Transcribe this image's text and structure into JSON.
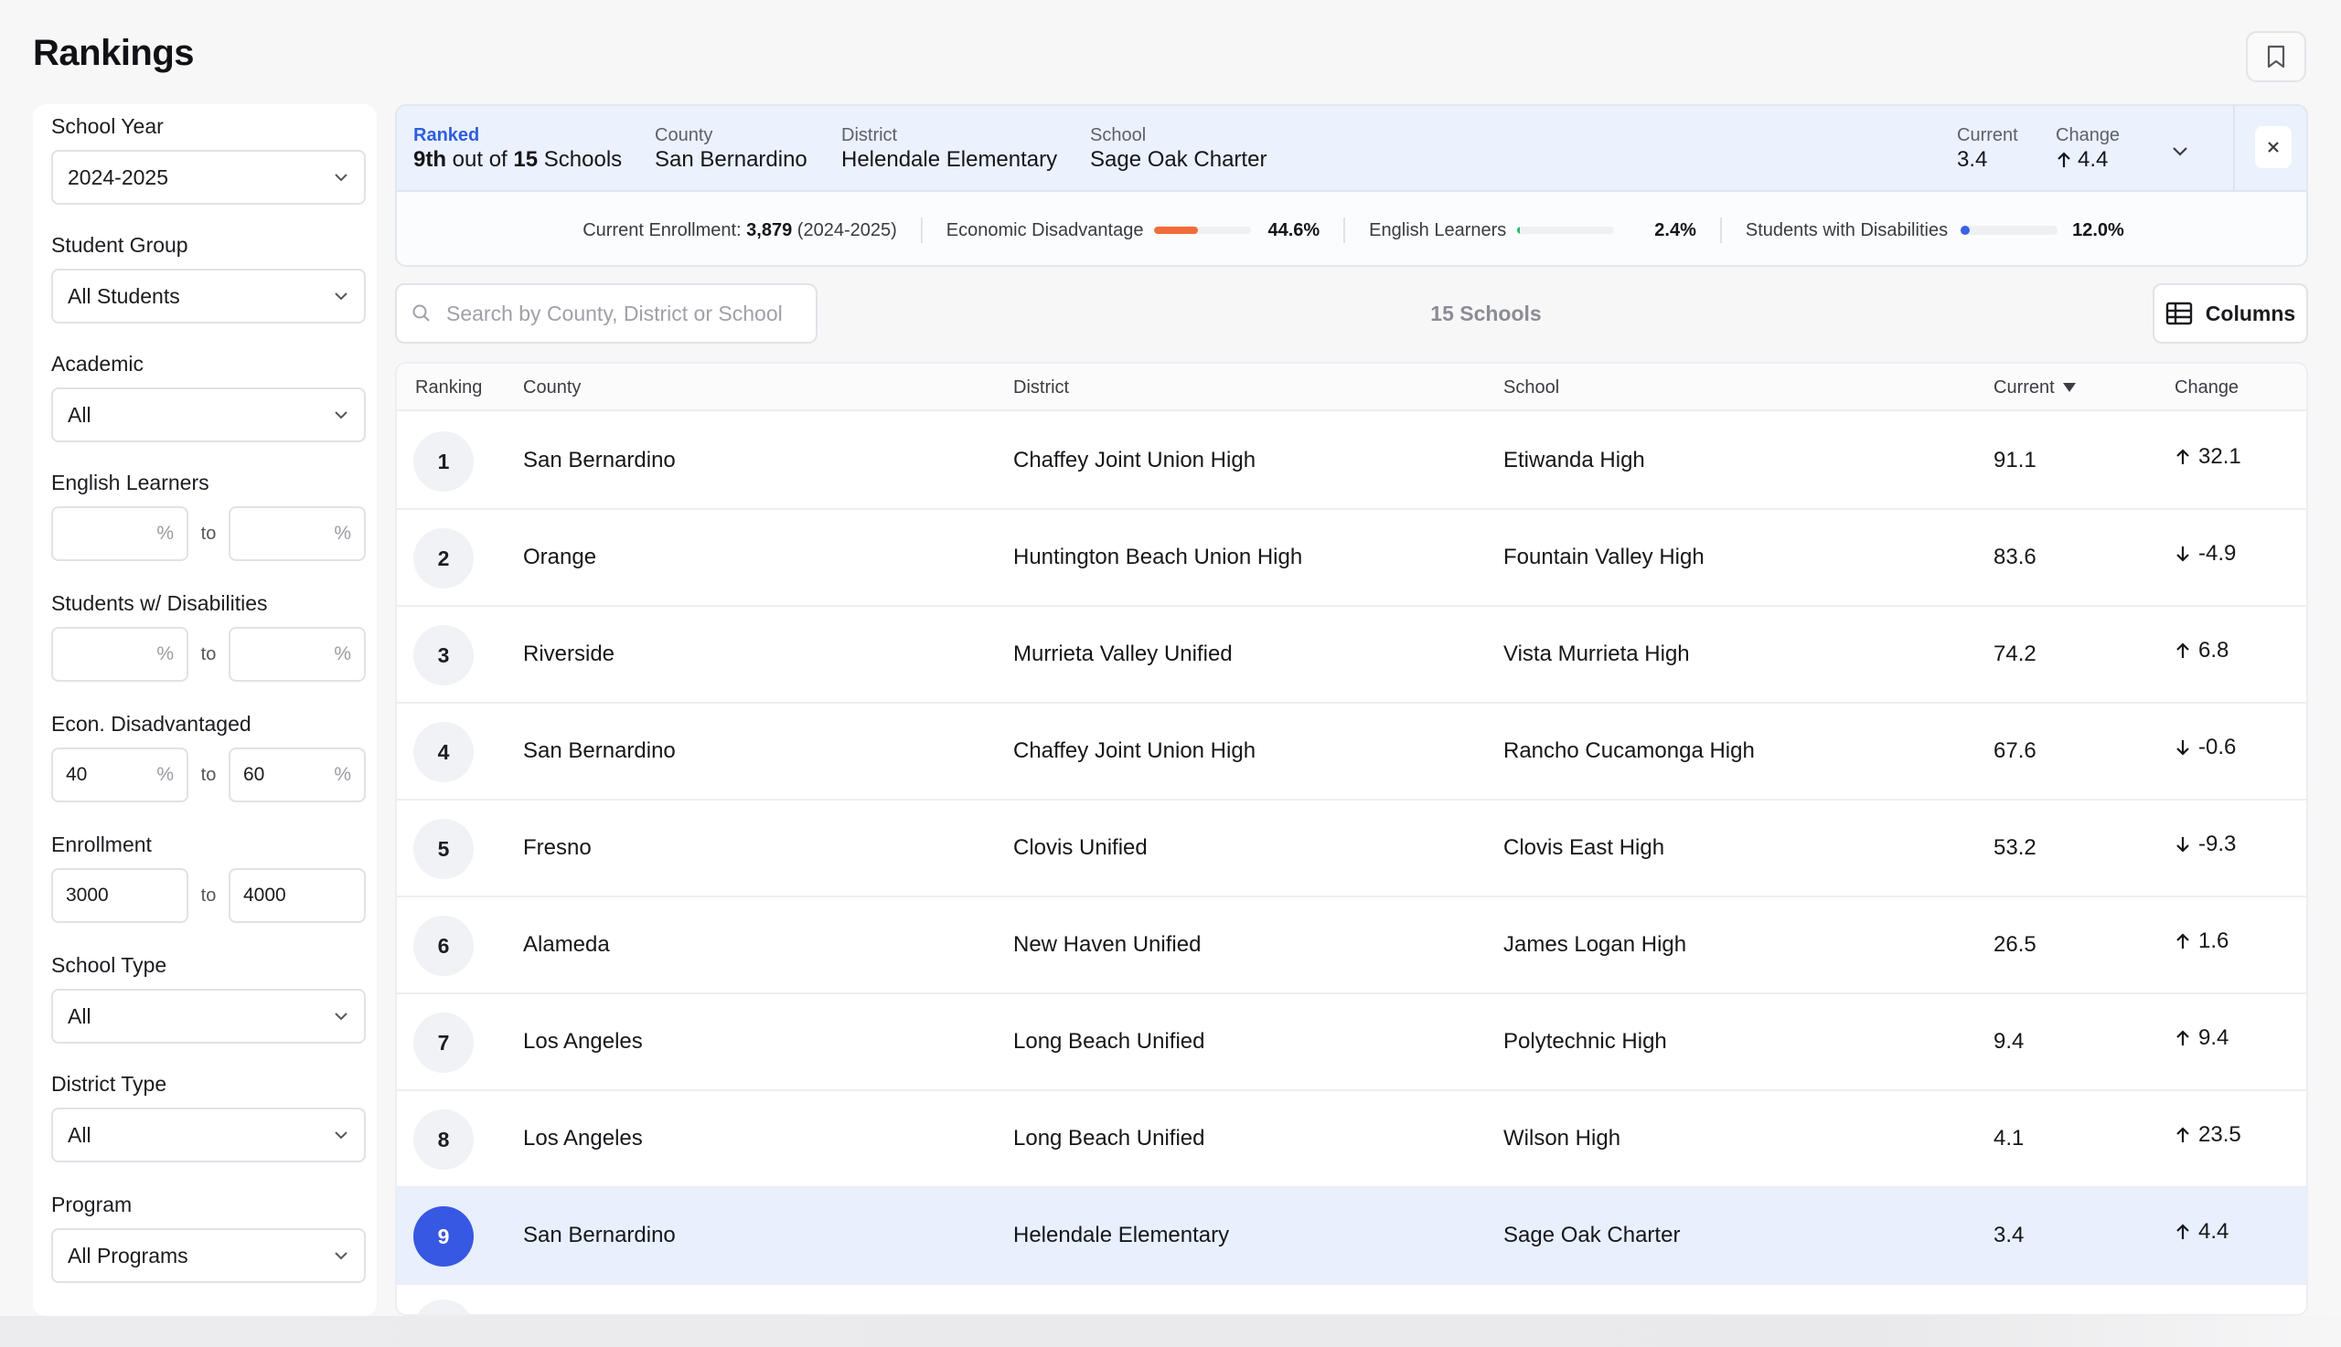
{
  "page": {
    "title": "Rankings"
  },
  "filters": {
    "school_year": {
      "label": "School Year",
      "value": "2024-2025"
    },
    "student_group": {
      "label": "Student Group",
      "value": "All Students"
    },
    "academic": {
      "label": "Academic",
      "value": "All"
    },
    "english_learners": {
      "label": "English Learners",
      "from": "",
      "to": "",
      "unit": "%",
      "to_label": "to"
    },
    "disabilities": {
      "label": "Students w/ Disabilities",
      "from": "",
      "to": "",
      "unit": "%",
      "to_label": "to"
    },
    "econ": {
      "label": "Econ. Disadvantaged",
      "from": "40",
      "to": "60",
      "unit": "%",
      "to_label": "to"
    },
    "enrollment": {
      "label": "Enrollment",
      "from": "3000",
      "to": "4000",
      "to_label": "to"
    },
    "school_type": {
      "label": "School Type",
      "value": "All"
    },
    "district_type": {
      "label": "District Type",
      "value": "All"
    },
    "program": {
      "label": "Program",
      "value": "All Programs"
    }
  },
  "summary": {
    "ranked_label": "Ranked",
    "ranked_position": "9th",
    "ranked_out_of_text": "out of",
    "ranked_total": "15",
    "ranked_schools_text": "Schools",
    "county_label": "County",
    "county": "San Bernardino",
    "district_label": "District",
    "district": "Helendale Elementary",
    "school_label": "School",
    "school": "Sage Oak Charter",
    "current_label": "Current",
    "current": "3.4",
    "change_label": "Change",
    "change": "4.4",
    "enrollment_label": "Current Enrollment:",
    "enrollment_value": "3,879",
    "enrollment_year": "(2024-2025)",
    "econ_label": "Economic Disadvantage",
    "econ_value": "44.6%",
    "econ_fraction": 0.446,
    "el_label": "English Learners",
    "el_value": "2.4%",
    "el_fraction": 0.024,
    "swd_label": "Students with Disabilities",
    "swd_value": "12.0%",
    "colors": {
      "econ": "#f26b3a",
      "el": "#2fb36a",
      "swd": "#3b63e6",
      "accent": "#3758e3"
    }
  },
  "toolbar": {
    "search_placeholder": "Search by County, District or School",
    "count": "15 Schools",
    "columns_label": "Columns"
  },
  "table": {
    "headers": {
      "ranking": "Ranking",
      "county": "County",
      "district": "District",
      "school": "School",
      "current": "Current",
      "change": "Change"
    },
    "rows": [
      {
        "rank": "1",
        "county": "San Bernardino",
        "district": "Chaffey Joint Union High",
        "school": "Etiwanda High",
        "current": "91.1",
        "change": "32.1",
        "dir": "up"
      },
      {
        "rank": "2",
        "county": "Orange",
        "district": "Huntington Beach Union High",
        "school": "Fountain Valley High",
        "current": "83.6",
        "change": "-4.9",
        "dir": "down"
      },
      {
        "rank": "3",
        "county": "Riverside",
        "district": "Murrieta Valley Unified",
        "school": "Vista Murrieta High",
        "current": "74.2",
        "change": "6.8",
        "dir": "up"
      },
      {
        "rank": "4",
        "county": "San Bernardino",
        "district": "Chaffey Joint Union High",
        "school": "Rancho Cucamonga High",
        "current": "67.6",
        "change": "-0.6",
        "dir": "down"
      },
      {
        "rank": "5",
        "county": "Fresno",
        "district": "Clovis Unified",
        "school": "Clovis East High",
        "current": "53.2",
        "change": "-9.3",
        "dir": "down"
      },
      {
        "rank": "6",
        "county": "Alameda",
        "district": "New Haven Unified",
        "school": "James Logan High",
        "current": "26.5",
        "change": "1.6",
        "dir": "up"
      },
      {
        "rank": "7",
        "county": "Los Angeles",
        "district": "Long Beach Unified",
        "school": "Polytechnic High",
        "current": "9.4",
        "change": "9.4",
        "dir": "up"
      },
      {
        "rank": "8",
        "county": "Los Angeles",
        "district": "Long Beach Unified",
        "school": "Wilson High",
        "current": "4.1",
        "change": "23.5",
        "dir": "up"
      },
      {
        "rank": "9",
        "county": "San Bernardino",
        "district": "Helendale Elementary",
        "school": "Sage Oak Charter",
        "current": "3.4",
        "change": "4.4",
        "dir": "up",
        "selected": true
      }
    ]
  }
}
